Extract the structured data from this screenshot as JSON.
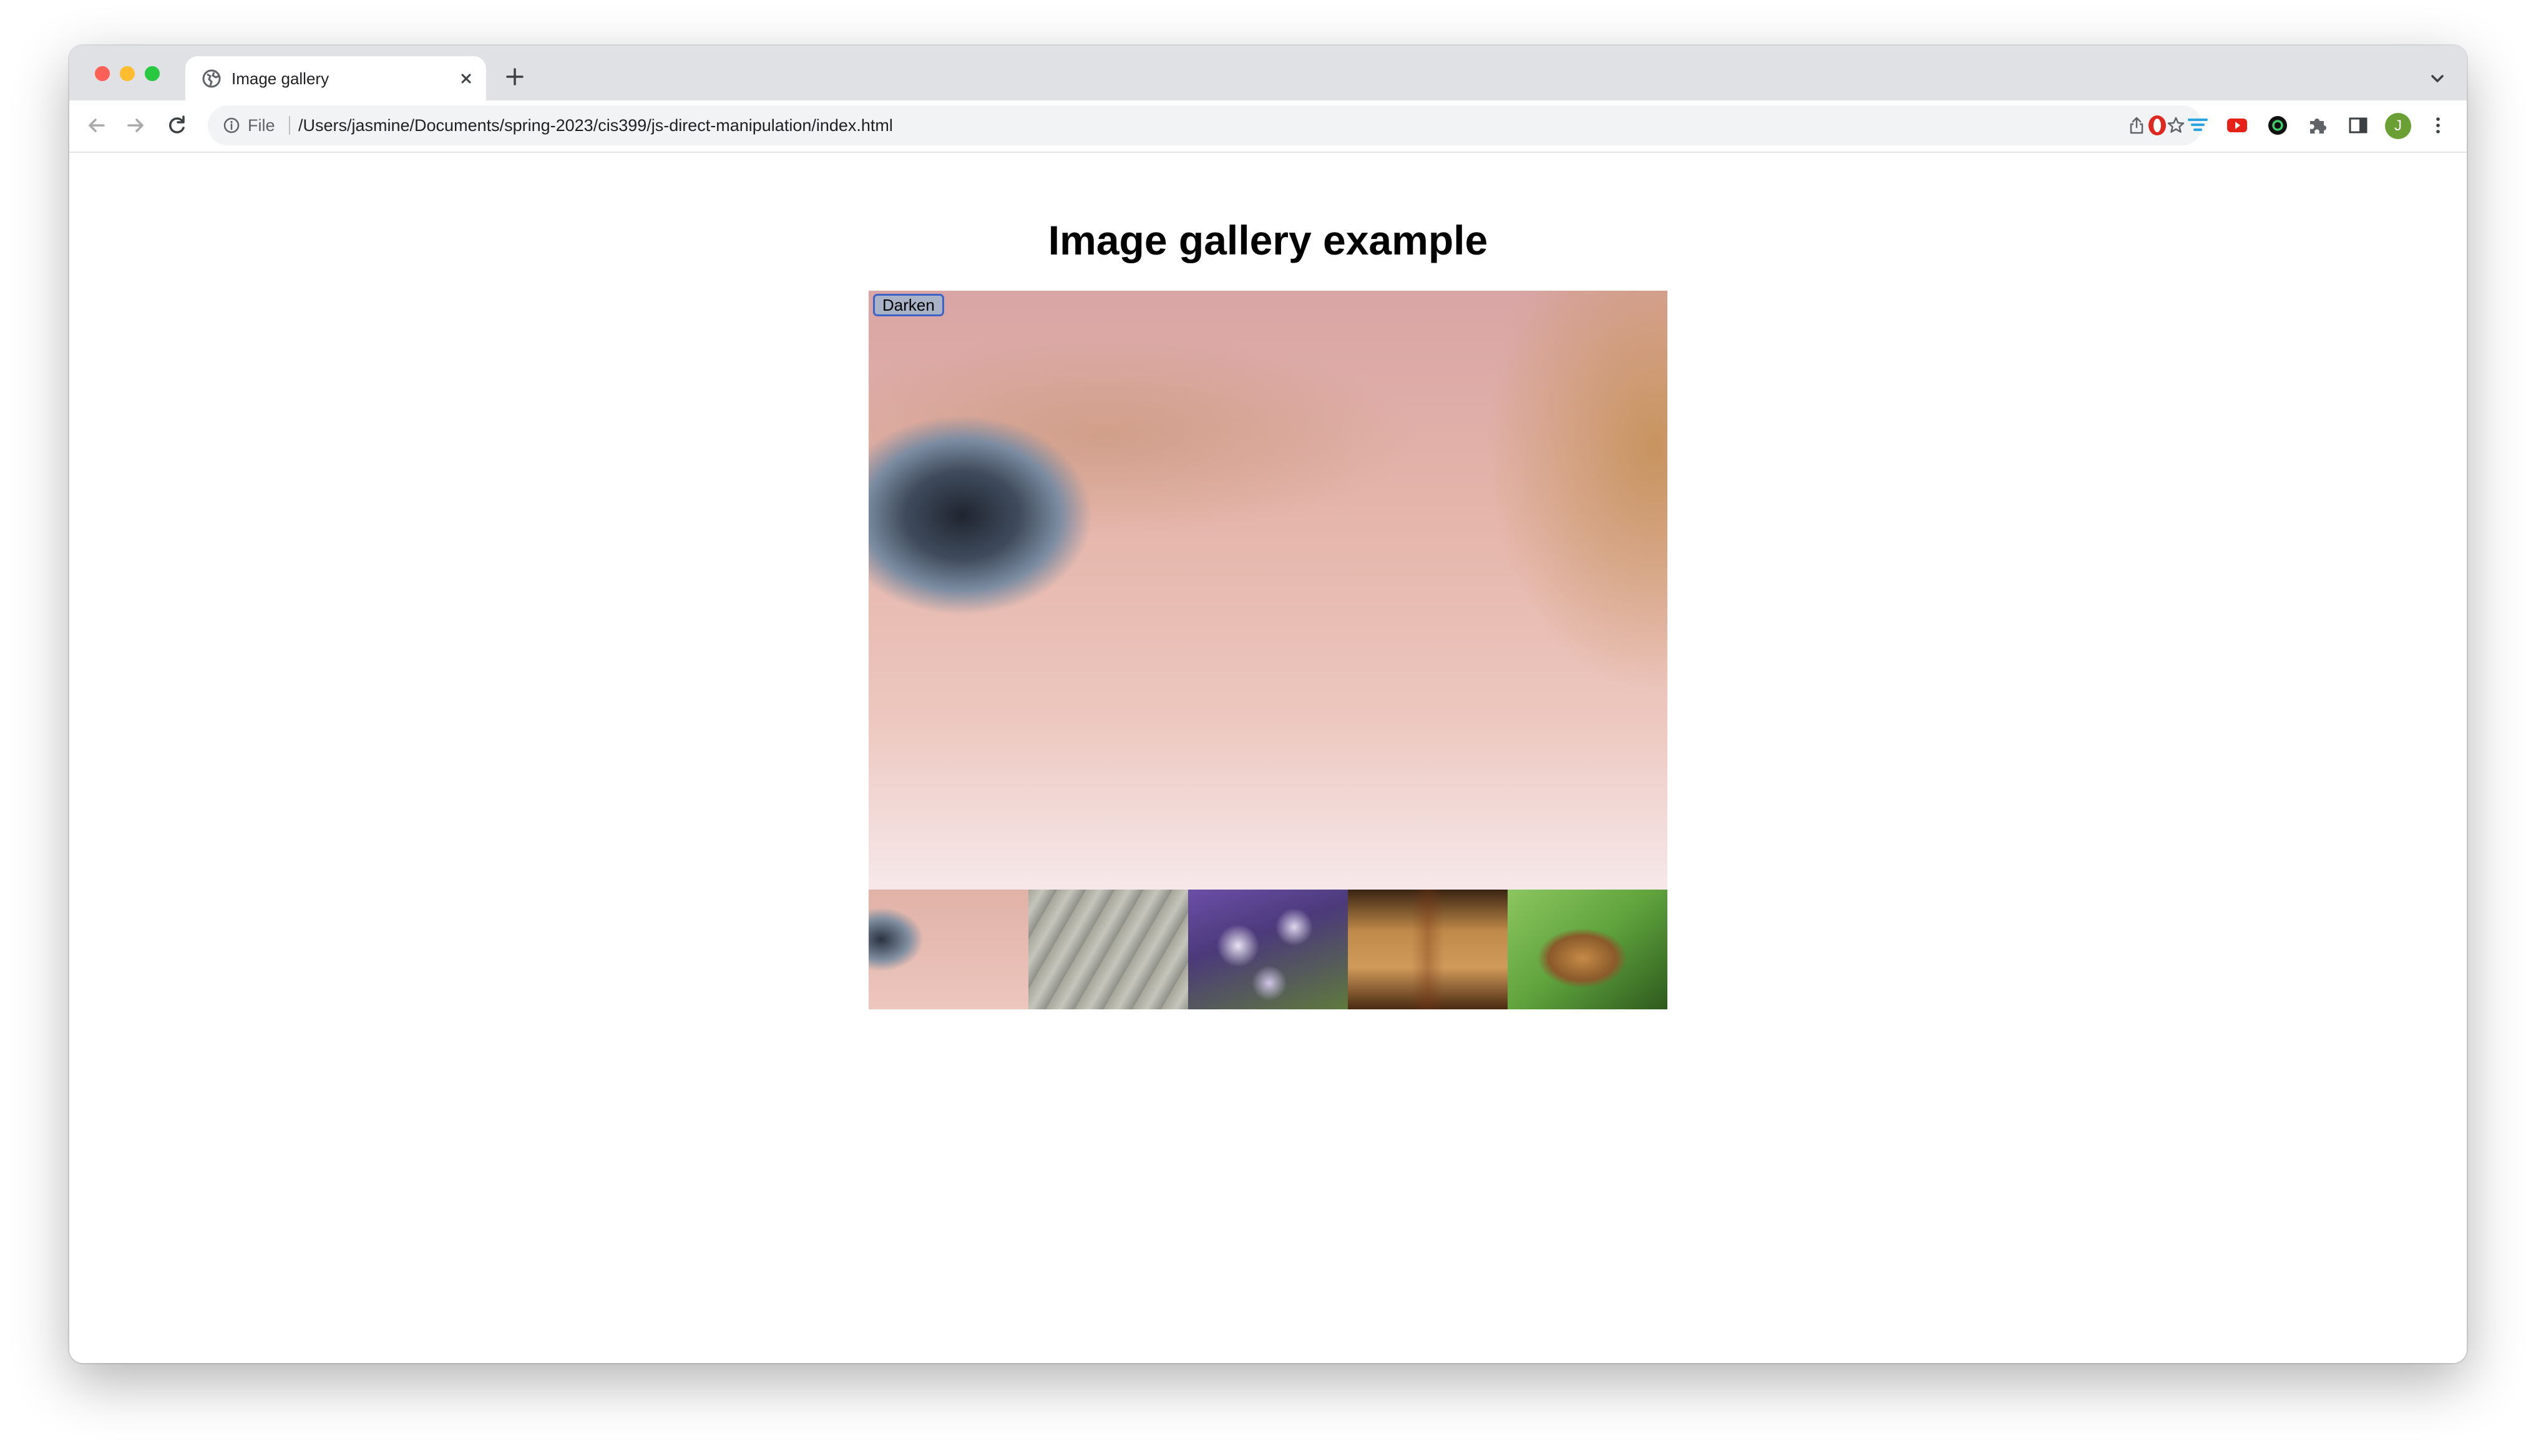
{
  "browser": {
    "tab": {
      "title": "Image gallery",
      "favicon": "globe-icon"
    },
    "address_bar": {
      "scheme_label": "File",
      "url": "/Users/jasmine/Documents/spring-2023/cis399/js-direct-manipulation/index.html"
    },
    "extensions": [
      "opera-icon",
      "filter-icon",
      "youtube-icon",
      "circle-icon",
      "puzzle-icon",
      "side-panel-icon"
    ],
    "profile_initial": "J",
    "colors": {
      "tab_bar": "#dfe1e5",
      "omnibox": "#f1f3f4",
      "avatar": "#6a9f34"
    }
  },
  "page": {
    "heading": "Image gallery example",
    "darken_button": "Darken",
    "main_image": "eye-closeup",
    "thumbnails": [
      "eye-closeup",
      "seashell",
      "purple-flowers",
      "egyptian-painting",
      "butterfly"
    ],
    "accent": "#3b64c9"
  }
}
